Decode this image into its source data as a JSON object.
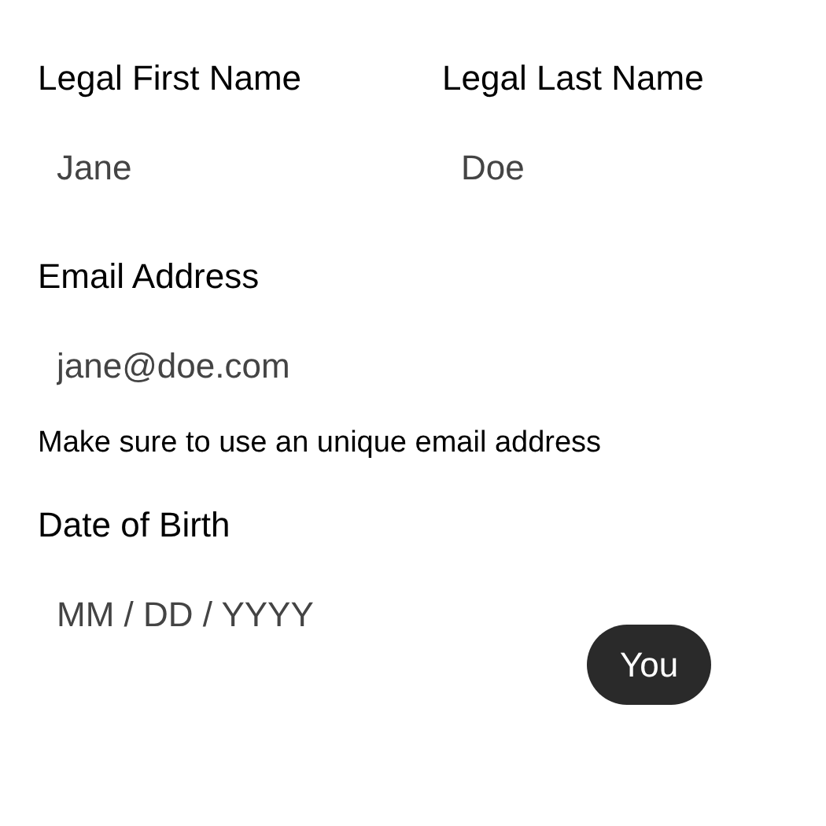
{
  "name_fields": [
    {
      "label": "Legal First Name",
      "placeholder": "Jane"
    },
    {
      "label": "Legal Last Name",
      "placeholder": "Doe"
    }
  ],
  "email": {
    "label": "Email Address",
    "placeholder": "jane@doe.com",
    "help": "Make sure to use an unique email address"
  },
  "birth_date": {
    "label": "Date of Birth",
    "placeholder": "MM / DD / YYYY"
  },
  "cursor_label": "You"
}
